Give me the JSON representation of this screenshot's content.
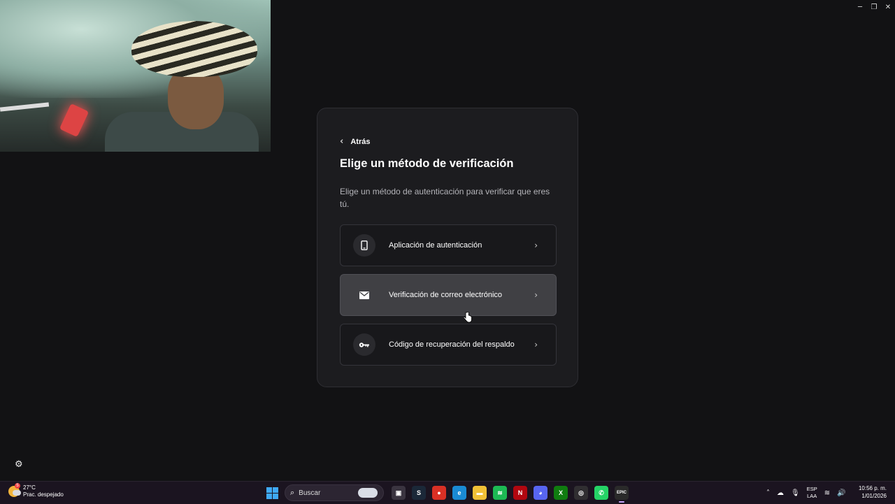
{
  "window": {
    "controls": {
      "minimize": "─",
      "restore": "❐",
      "close": "✕"
    }
  },
  "verification": {
    "back_label": "Atrás",
    "title": "Elige un método de verificación",
    "description": "Elige un método de autenticación para verificar que eres tú.",
    "options": [
      {
        "label": "Aplicación de autenticación",
        "icon": "phone-icon"
      },
      {
        "label": "Verificación de correo electrónico",
        "icon": "mail-icon",
        "hovered": true
      },
      {
        "label": "Código de recuperación del respaldo",
        "icon": "key-icon"
      }
    ]
  },
  "taskbar": {
    "weather": {
      "temp": "27°C",
      "condition": "Prac. despejado",
      "badge": "5"
    },
    "search_placeholder": "Buscar",
    "apps": [
      {
        "name": "task-view",
        "glyph": "▣",
        "color": "#3a3440"
      },
      {
        "name": "steam",
        "glyph": "S",
        "color": "#1b2838"
      },
      {
        "name": "chrome",
        "glyph": "●",
        "color": "#d93025"
      },
      {
        "name": "edge",
        "glyph": "e",
        "color": "#1a8ad4"
      },
      {
        "name": "file-explorer",
        "glyph": "▬",
        "color": "#f2c037"
      },
      {
        "name": "spotify",
        "glyph": "≋",
        "color": "#1db954"
      },
      {
        "name": "netflix",
        "glyph": "N",
        "color": "#b20710"
      },
      {
        "name": "discord",
        "glyph": "◕",
        "color": "#5865f2"
      },
      {
        "name": "xbox",
        "glyph": "X",
        "color": "#107c10"
      },
      {
        "name": "obs",
        "glyph": "◎",
        "color": "#302e31"
      },
      {
        "name": "whatsapp",
        "glyph": "✆",
        "color": "#25d366"
      },
      {
        "name": "epic-games",
        "glyph": "EPIC",
        "color": "#2a2a2a"
      }
    ],
    "lang": {
      "line1": "ESP",
      "line2": "LAA"
    },
    "time": "10:56 p. m.",
    "date": "1/01/2026"
  }
}
